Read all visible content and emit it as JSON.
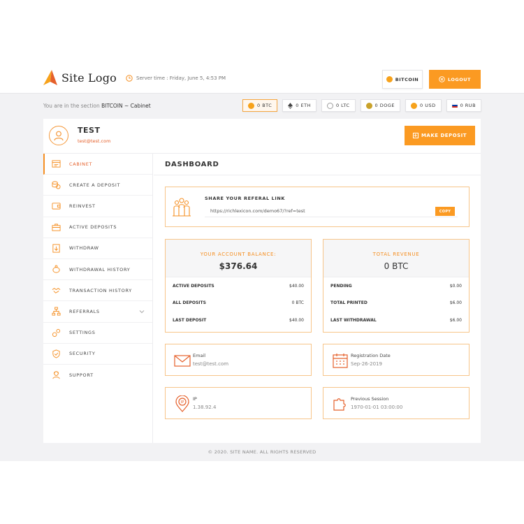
{
  "header": {
    "logo_text": "Site Logo",
    "server_time": "Server time : Friday, June 5, 4:53 PM",
    "bitcoin_button": "BITCOIN",
    "logout_button": "LOGOUT"
  },
  "section": {
    "prefix": "You are in the section",
    "path": "BITCOIN ~ Cabinet"
  },
  "currencies": [
    {
      "label": "0 BTC",
      "icon": "bitcoin-icon",
      "color": "#f7a21b"
    },
    {
      "label": "0 ETH",
      "icon": "ethereum-icon",
      "color": "#555555"
    },
    {
      "label": "0 LTC",
      "icon": "litecoin-icon",
      "color": "#9e9e9e"
    },
    {
      "label": "0 DOGE",
      "icon": "doge-icon",
      "color": "#c9a22a"
    },
    {
      "label": "0 USD",
      "icon": "usd-icon",
      "color": "#f7a21b"
    },
    {
      "label": "0 RUB",
      "icon": "ruble-flag-icon",
      "color": "#d52b1e"
    }
  ],
  "user": {
    "name": "TEST",
    "email": "test@test.com"
  },
  "make_deposit_button": "MAKE DEPOSIT",
  "sidebar": {
    "items": [
      {
        "label": "CABINET"
      },
      {
        "label": "CREATE A DEPOSIT"
      },
      {
        "label": "REINVEST"
      },
      {
        "label": "ACTIVE DEPOSITS"
      },
      {
        "label": "WITHDRAW"
      },
      {
        "label": "WITHDRAWAL HISTORY"
      },
      {
        "label": "TRANSACTION HISTORY"
      },
      {
        "label": "REFERRALS"
      },
      {
        "label": "SETTINGS"
      },
      {
        "label": "SECURITY"
      },
      {
        "label": "SUPPORT"
      }
    ]
  },
  "main": {
    "title": "DASHBOARD",
    "referral": {
      "title": "SHARE YOUR REFERAL LINK",
      "link": "https://richlexicon.com/demo67/?ref=test",
      "copy_button": "COPY"
    },
    "balance": {
      "label": "YOUR ACCOUNT BALANCE:",
      "value": "$376.64",
      "rows": [
        {
          "label": "ACTIVE DEPOSITS",
          "value": "$40.00"
        },
        {
          "label": "ALL DEPOSITS",
          "value": "0 BTC"
        },
        {
          "label": "LAST DEPOSIT",
          "value": "$40.00"
        }
      ]
    },
    "revenue": {
      "label": "TOTAL REVENUE",
      "value": "0 BTC",
      "rows": [
        {
          "label": "PENDING",
          "value": "$0.00"
        },
        {
          "label": "TOTAL PRINTED",
          "value": "$6.00"
        },
        {
          "label": "LAST WITHDRAWAL",
          "value": "$6.00"
        }
      ]
    },
    "info": {
      "email": {
        "label": "Email",
        "value": "test@test.com"
      },
      "registration": {
        "label": "Registration Date",
        "value": "Sep-26-2019"
      },
      "ip": {
        "label": "IP",
        "value": "1.38.92.4"
      },
      "previous_session": {
        "label": "Previous Session",
        "value": "1970-01-01 03:00:00"
      }
    }
  },
  "footer": "© 2020. SITE NAME. ALL RIGHTS RESERVED",
  "colors": {
    "accent": "#fb9a22",
    "accent_text": "#f58f22",
    "email_text": "#e5602b"
  }
}
